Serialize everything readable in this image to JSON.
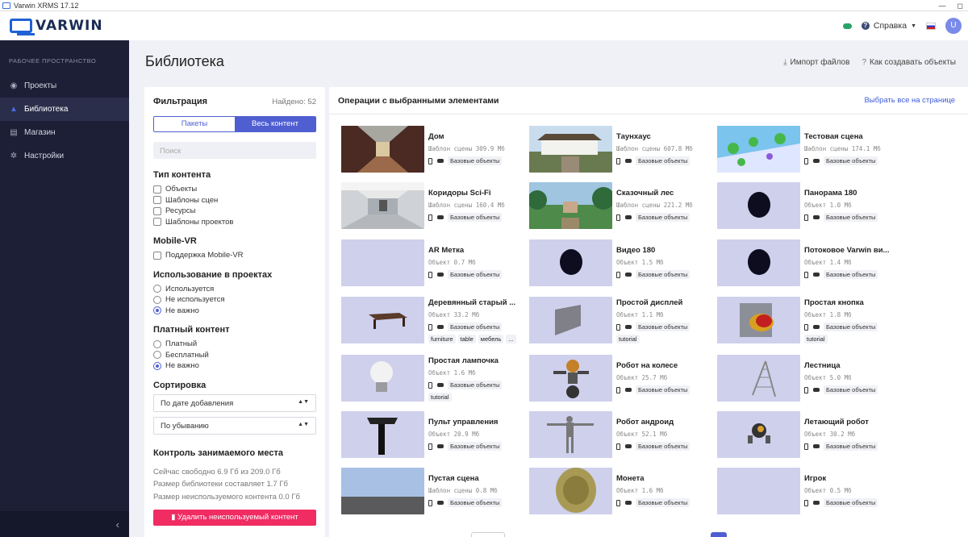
{
  "window": {
    "title": "Varwin XRMS 17.12",
    "btn_min": "—",
    "btn_max": "◻"
  },
  "header": {
    "logo": "VARWIN",
    "help": "Справка",
    "avatar": "U"
  },
  "sidebar": {
    "section": "РАБОЧЕЕ ПРОСТРАНСТВО",
    "items": [
      {
        "label": "Проекты",
        "icon": "compass-icon"
      },
      {
        "label": "Библиотека",
        "icon": "library-icon"
      },
      {
        "label": "Магазин",
        "icon": "store-icon"
      },
      {
        "label": "Настройки",
        "icon": "gear-icon"
      }
    ],
    "collapse": "‹"
  },
  "page": {
    "title": "Библиотека",
    "import": "Импорт файлов",
    "howto": "Как создавать объекты"
  },
  "filter": {
    "title": "Фильтрация",
    "found": "Найдено: 52",
    "seg_packages": "Пакеты",
    "seg_all": "Весь контент",
    "search_placeholder": "Поиск",
    "content_type": {
      "title": "Тип контента",
      "options": [
        "Объекты",
        "Шаблоны сцен",
        "Ресурсы",
        "Шаблоны проектов"
      ]
    },
    "mobile": {
      "title": "Mobile-VR",
      "option": "Поддержка Mobile-VR"
    },
    "usage": {
      "title": "Использование в проектах",
      "options": [
        "Используется",
        "Не используется",
        "Не важно"
      ],
      "selected": 2
    },
    "paid": {
      "title": "Платный контент",
      "options": [
        "Платный",
        "Бесплатный",
        "Не важно"
      ],
      "selected": 2
    },
    "sort": {
      "title": "Сортировка",
      "by": "По дате добавления",
      "order": "По убыванию"
    },
    "storage": {
      "title": "Контроль занимаемого места",
      "free": "Сейчас свободно 6.9 Гб из 209.0 Гб",
      "lib": "Размер библиотеки составляет 1.7 Гб",
      "unused": "Размер неиспользуемого контента 0.0 Гб",
      "delete": "Удалить неиспользуемый контент"
    }
  },
  "main": {
    "ops_title": "Операции с выбранными элементами",
    "select_all": "Выбрать все на странице",
    "base_tag": "Базовые объекты",
    "cards": [
      {
        "name": "Дом",
        "meta": "Шаблон сцены  309.9 Мб",
        "thumb": "corridor",
        "extra": []
      },
      {
        "name": "Таунхаус",
        "meta": "Шаблон сцены  607.8 Мб",
        "thumb": "townhouse",
        "extra": []
      },
      {
        "name": "Тестовая сцена",
        "meta": "Шаблон сцены  174.1 Мб",
        "thumb": "testscene",
        "extra": []
      },
      {
        "name": "Коридоры Sci-Fi",
        "meta": "Шаблон сцены  160.4 Мб",
        "thumb": "scifi",
        "extra": []
      },
      {
        "name": "Сказочный лес",
        "meta": "Шаблон сцены  221.2 Мб",
        "thumb": "forest",
        "extra": []
      },
      {
        "name": "Панорама 180",
        "meta": "Объект  1.0 Мб",
        "thumb": "sphere",
        "extra": []
      },
      {
        "name": "AR Метка",
        "meta": "Объект  0.7 Мб",
        "thumb": "empty",
        "extra": []
      },
      {
        "name": "Видео 180",
        "meta": "Объект  1.5 Мб",
        "thumb": "sphere",
        "extra": []
      },
      {
        "name": "Потоковое Varwin ви...",
        "meta": "Объект  1.4 Мб",
        "thumb": "sphere",
        "extra": []
      },
      {
        "name": "Деревянный старый ...",
        "meta": "Объект  33.2 Мб",
        "thumb": "table",
        "extra": [
          "furniture",
          "table",
          "мебель",
          "..."
        ]
      },
      {
        "name": "Простой дисплей",
        "meta": "Объект  1.1 Мб",
        "thumb": "display",
        "extra": [
          "tutorial"
        ]
      },
      {
        "name": "Простая кнопка",
        "meta": "Объект  1.8 Мб",
        "thumb": "button",
        "extra": [
          "tutorial"
        ]
      },
      {
        "name": "Простая лампочка",
        "meta": "Объект  1.6 Мб",
        "thumb": "bulb",
        "extra": [
          "tutorial"
        ]
      },
      {
        "name": "Робот на колесе",
        "meta": "Объект  25.7 Мб",
        "thumb": "robotwheel",
        "extra": []
      },
      {
        "name": "Лестница",
        "meta": "Объект  5.0 Мб",
        "thumb": "ladder",
        "extra": []
      },
      {
        "name": "Пульт управления",
        "meta": "Объект  20.9 Мб",
        "thumb": "console",
        "extra": []
      },
      {
        "name": "Робот андроид",
        "meta": "Объект  52.1 Мб",
        "thumb": "android",
        "extra": []
      },
      {
        "name": "Летающий робот",
        "meta": "Объект  30.2 Мб",
        "thumb": "flyrobot",
        "extra": []
      },
      {
        "name": "Пустая сцена",
        "meta": "Шаблон сцены  0.8 Мб",
        "thumb": "emptyscene",
        "extra": []
      },
      {
        "name": "Монета",
        "meta": "Объект  1.6 Мб",
        "thumb": "coin",
        "extra": []
      },
      {
        "name": "Игрок",
        "meta": "Объект  0.5 Мб",
        "thumb": "empty",
        "extra": []
      }
    ]
  },
  "colors": {
    "accent": "#4f5fd1",
    "danger": "#f02c63",
    "sidebar": "#1c1f36"
  }
}
